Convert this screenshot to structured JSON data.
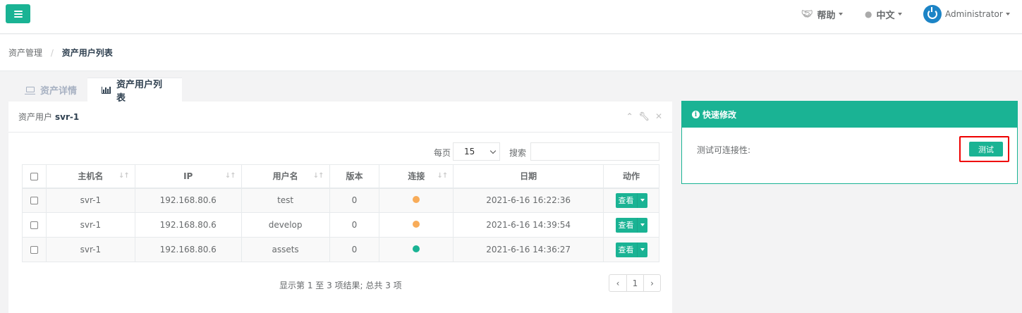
{
  "navbar": {
    "help_label": "帮助",
    "lang_label": "中文",
    "user_label": "Administrator"
  },
  "breadcrumb": {
    "parent": "资产管理",
    "separator": "/",
    "current": "资产用户列表"
  },
  "tabs": [
    {
      "label": "资产详情",
      "icon": "laptop-icon",
      "active": false
    },
    {
      "label": "资产用户列表",
      "icon": "bar-chart-icon",
      "active": true
    }
  ],
  "panel": {
    "title_prefix": "资产用户",
    "title_asset": "svr-1",
    "per_page_label": "每页",
    "per_page_value": "15",
    "search_label": "搜索",
    "search_value": "",
    "columns": [
      "主机名",
      "IP",
      "用户名",
      "版本",
      "连接",
      "日期",
      "动作"
    ],
    "rows": [
      {
        "hostname": "svr-1",
        "ip": "192.168.80.6",
        "username": "test",
        "version": "0",
        "connection": "#f8ac59",
        "date": "2021-6-16 16:22:36",
        "action": "查看"
      },
      {
        "hostname": "svr-1",
        "ip": "192.168.80.6",
        "username": "develop",
        "version": "0",
        "connection": "#f8ac59",
        "date": "2021-6-16 14:39:54",
        "action": "查看"
      },
      {
        "hostname": "svr-1",
        "ip": "192.168.80.6",
        "username": "assets",
        "version": "0",
        "connection": "#1ab394",
        "date": "2021-6-16 14:36:27",
        "action": "查看"
      }
    ],
    "summary": "显示第 1 至 3 项结果; 总共 3 项",
    "pagination": {
      "prev": "‹",
      "page": "1",
      "next": "›"
    }
  },
  "quick_edit": {
    "title": "快速修改",
    "test_label": "测试可连接性:",
    "test_button": "测试"
  },
  "colors": {
    "primary": "#1ab394",
    "warning": "#f8ac59",
    "highlight": "#ee0000"
  }
}
